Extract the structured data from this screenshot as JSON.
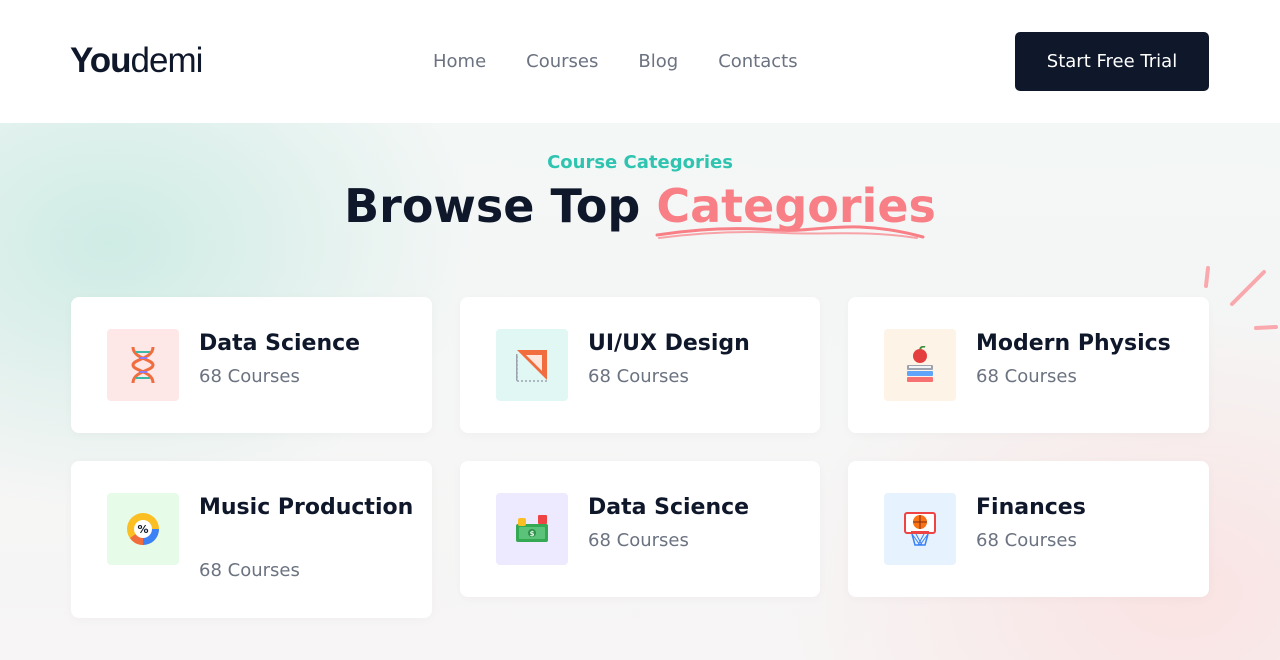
{
  "header": {
    "logo_bold": "You",
    "logo_light": "demi",
    "nav": [
      "Home",
      "Courses",
      "Blog",
      "Contacts"
    ],
    "cta_label": "Start Free Trial"
  },
  "hero": {
    "eyebrow": "Course Categories",
    "title_main": "Browse Top ",
    "title_accent": "Categories"
  },
  "categories": [
    {
      "title": "Data Science",
      "count": "68 Courses",
      "icon": "dna-icon",
      "bg": "#fde7e7"
    },
    {
      "title": "UI/UX Design",
      "count": "68 Courses",
      "icon": "set-square-icon",
      "bg": "#e0f7f4"
    },
    {
      "title": "Modern Physics",
      "count": "68 Courses",
      "icon": "books-apple-icon",
      "bg": "#fdf3e7"
    },
    {
      "title": "Music Production",
      "count": "68 Courses",
      "icon": "percent-chart-icon",
      "bg": "#e6fbe8"
    },
    {
      "title": "Data Science",
      "count": "68 Courses",
      "icon": "money-icon",
      "bg": "#ede9fe"
    },
    {
      "title": "Finances",
      "count": "68 Courses",
      "icon": "basketball-hoop-icon",
      "bg": "#e6f2fd"
    }
  ],
  "colors": {
    "brand_dark": "#0f172a",
    "accent_teal": "#2ec4b0",
    "accent_pink": "#f87f86"
  }
}
